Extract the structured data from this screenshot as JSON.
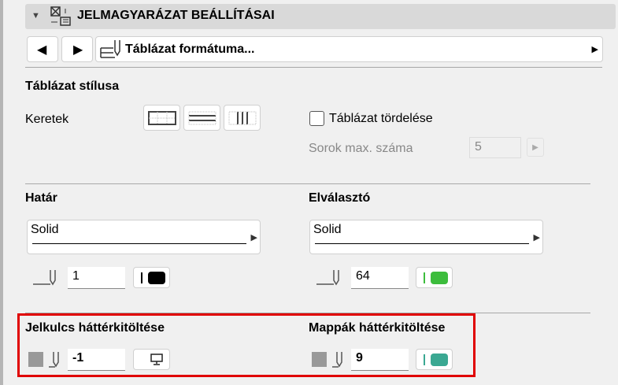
{
  "header": {
    "title": "JELMAGYARÁZAT BEÁLLÍTÁSAI"
  },
  "nav": {
    "dropdown_label": "Táblázat formátuma..."
  },
  "table_style": {
    "heading": "Táblázat stílusa",
    "frames_label": "Keretek",
    "wrap_label": "Táblázat tördelése",
    "wrap_checked": false,
    "max_rows_label": "Sorok max. száma",
    "max_rows_value": "5"
  },
  "border": {
    "heading": "Határ",
    "line_type": "Solid",
    "pen_value": "1",
    "color": "#000000"
  },
  "separator": {
    "heading": "Elválasztó",
    "line_type": "Solid",
    "pen_value": "64",
    "color": "#3dbd3d"
  },
  "key_bg": {
    "heading": "Jelkulcs háttérkitöltése",
    "pen_value": "-1"
  },
  "folder_bg": {
    "heading": "Mappák háttérkitöltése",
    "pen_value": "9",
    "color": "#3aa892"
  },
  "colors": {
    "highlight": "#e00000"
  }
}
